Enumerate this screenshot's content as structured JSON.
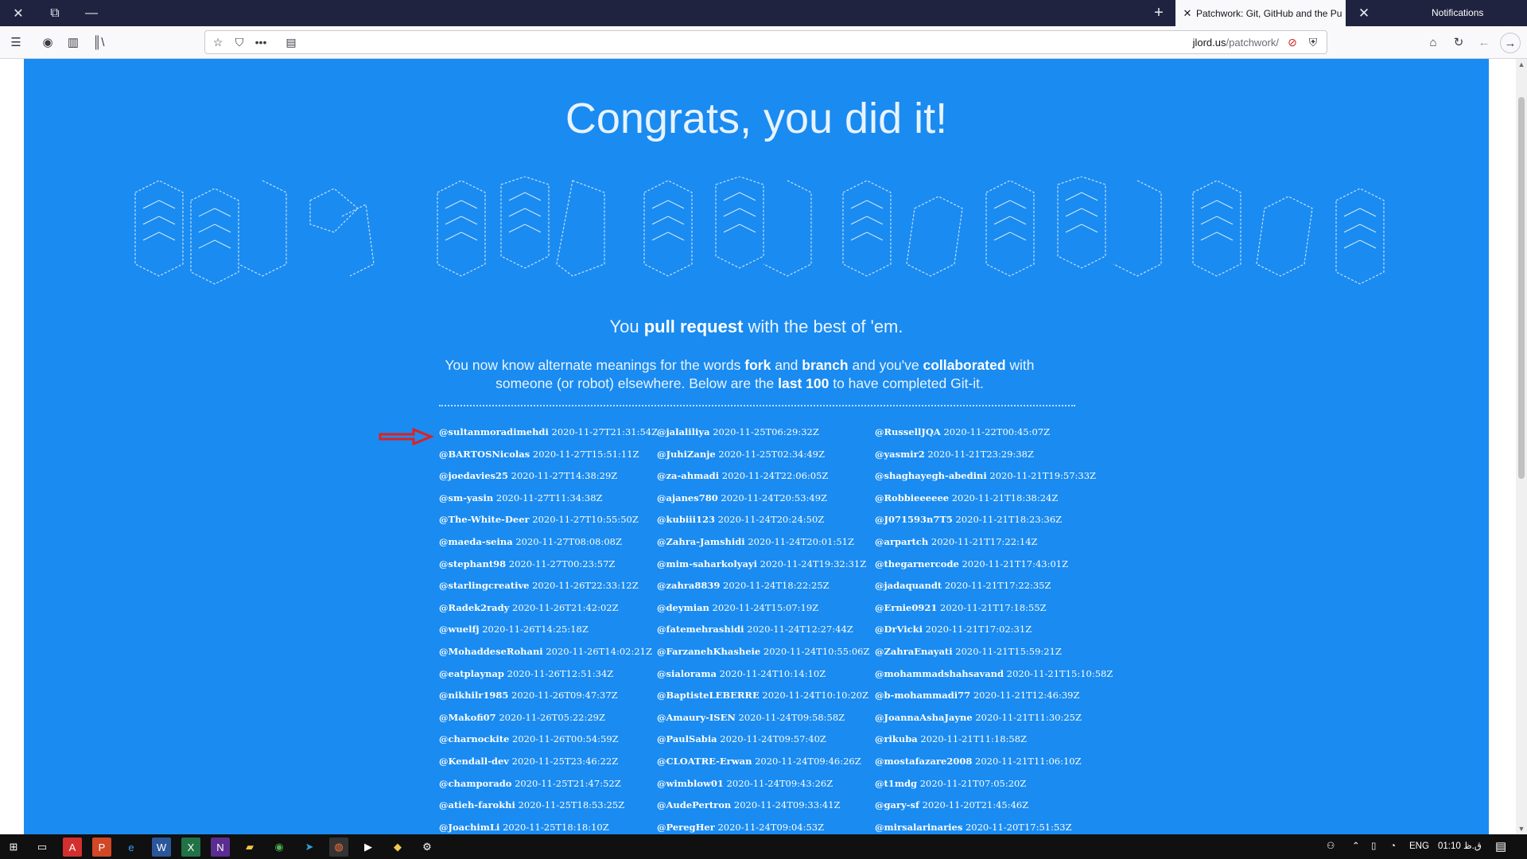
{
  "browser": {
    "tab_title": "Patchwork: Git, GitHub and the Pu",
    "notifications_label": "Notifications",
    "url_host": "jlord.us",
    "url_path": "/patchwork/"
  },
  "page": {
    "heading": "Congrats, you did it!",
    "lead_prefix": "You ",
    "lead_bold": "pull request",
    "lead_suffix": " with the best of 'em.",
    "para_1": "You now know alternate meanings for the words ",
    "para_fork": "fork",
    "para_2": " and ",
    "para_branch": "branch",
    "para_3": " and you've ",
    "para_collab": "collaborated",
    "para_4": " with someone (or robot) elsewhere. Below are the ",
    "para_last": "last 100",
    "para_5": " to have completed Git-it."
  },
  "completions": [
    [
      {
        "user": "@sultanmoradimehdi",
        "time": "2020-11-27T21:31:54Z"
      },
      {
        "user": "@BARTOSNicolas",
        "time": "2020-11-27T15:51:11Z"
      },
      {
        "user": "@joedavies25",
        "time": "2020-11-27T14:38:29Z"
      },
      {
        "user": "@sm-yasin",
        "time": "2020-11-27T11:34:38Z"
      },
      {
        "user": "@The-White-Deer",
        "time": "2020-11-27T10:55:50Z"
      },
      {
        "user": "@maeda-seina",
        "time": "2020-11-27T08:08:08Z"
      },
      {
        "user": "@stephant98",
        "time": "2020-11-27T00:23:57Z"
      },
      {
        "user": "@starlingcreative",
        "time": "2020-11-26T22:33:12Z"
      },
      {
        "user": "@Radek2rady",
        "time": "2020-11-26T21:42:02Z"
      },
      {
        "user": "@wuelfj",
        "time": "2020-11-26T14:25:18Z"
      },
      {
        "user": "@MohaddeseRohani",
        "time": "2020-11-26T14:02:21Z"
      },
      {
        "user": "@eatplaynap",
        "time": "2020-11-26T12:51:34Z"
      },
      {
        "user": "@nikhilr1985",
        "time": "2020-11-26T09:47:37Z"
      },
      {
        "user": "@Makofi07",
        "time": "2020-11-26T05:22:29Z"
      },
      {
        "user": "@charnockite",
        "time": "2020-11-26T00:54:59Z"
      },
      {
        "user": "@Kendall-dev",
        "time": "2020-11-25T23:46:22Z"
      },
      {
        "user": "@champorado",
        "time": "2020-11-25T21:47:52Z"
      },
      {
        "user": "@atieh-farokhi",
        "time": "2020-11-25T18:53:25Z"
      },
      {
        "user": "@JoachimLi",
        "time": "2020-11-25T18:18:10Z"
      }
    ],
    [
      {
        "user": "@jalaliliya",
        "time": "2020-11-25T06:29:32Z"
      },
      {
        "user": "@JuhiZanje",
        "time": "2020-11-25T02:34:49Z"
      },
      {
        "user": "@za-ahmadi",
        "time": "2020-11-24T22:06:05Z"
      },
      {
        "user": "@ajanes780",
        "time": "2020-11-24T20:53:49Z"
      },
      {
        "user": "@kubiii123",
        "time": "2020-11-24T20:24:50Z"
      },
      {
        "user": "@Zahra-Jamshidi",
        "time": "2020-11-24T20:01:51Z"
      },
      {
        "user": "@mim-saharkolyayi",
        "time": "2020-11-24T19:32:31Z"
      },
      {
        "user": "@zahra8839",
        "time": "2020-11-24T18:22:25Z"
      },
      {
        "user": "@deymian",
        "time": "2020-11-24T15:07:19Z"
      },
      {
        "user": "@fatemehrashidi",
        "time": "2020-11-24T12:27:44Z"
      },
      {
        "user": "@FarzanehKhasheie",
        "time": "2020-11-24T10:55:06Z"
      },
      {
        "user": "@sialorama",
        "time": "2020-11-24T10:14:10Z"
      },
      {
        "user": "@BaptisteLEBERRE",
        "time": "2020-11-24T10:10:20Z"
      },
      {
        "user": "@Amaury-ISEN",
        "time": "2020-11-24T09:58:58Z"
      },
      {
        "user": "@PaulSabia",
        "time": "2020-11-24T09:57:40Z"
      },
      {
        "user": "@CLOATRE-Erwan",
        "time": "2020-11-24T09:46:26Z"
      },
      {
        "user": "@wimblow01",
        "time": "2020-11-24T09:43:26Z"
      },
      {
        "user": "@AudePertron",
        "time": "2020-11-24T09:33:41Z"
      },
      {
        "user": "@PeregHer",
        "time": "2020-11-24T09:04:53Z"
      }
    ],
    [
      {
        "user": "@RussellJQA",
        "time": "2020-11-22T00:45:07Z"
      },
      {
        "user": "@yasmir2",
        "time": "2020-11-21T23:29:38Z"
      },
      {
        "user": "@shaghayegh-abedini",
        "time": "2020-11-21T19:57:33Z"
      },
      {
        "user": "@Robbieeeeee",
        "time": "2020-11-21T18:38:24Z"
      },
      {
        "user": "@J071593n7T5",
        "time": "2020-11-21T18:23:36Z"
      },
      {
        "user": "@arpartch",
        "time": "2020-11-21T17:22:14Z"
      },
      {
        "user": "@thegarnercode",
        "time": "2020-11-21T17:43:01Z"
      },
      {
        "user": "@jadaquandt",
        "time": "2020-11-21T17:22:35Z"
      },
      {
        "user": "@Ernie0921",
        "time": "2020-11-21T17:18:55Z"
      },
      {
        "user": "@DrVicki",
        "time": "2020-11-21T17:02:31Z"
      },
      {
        "user": "@ZahraEnayati",
        "time": "2020-11-21T15:59:21Z"
      },
      {
        "user": "@mohammadshahsavand",
        "time": "2020-11-21T15:10:58Z"
      },
      {
        "user": "@b-mohammadi77",
        "time": "2020-11-21T12:46:39Z"
      },
      {
        "user": "@JoannaAshaJayne",
        "time": "2020-11-21T11:30:25Z"
      },
      {
        "user": "@rikuba",
        "time": "2020-11-21T11:18:58Z"
      },
      {
        "user": "@mostafazare2008",
        "time": "2020-11-21T11:06:10Z"
      },
      {
        "user": "@t1mdg",
        "time": "2020-11-21T07:05:20Z"
      },
      {
        "user": "@gary-sf",
        "time": "2020-11-20T21:45:46Z"
      },
      {
        "user": "@mirsalarinaries",
        "time": "2020-11-20T17:51:53Z"
      }
    ]
  ],
  "taskbar": {
    "language": "ENG",
    "clock": "01:10 ق.ظ"
  },
  "icons": {
    "back": "arrow-left-icon",
    "forward": "arrow-right-icon",
    "reload": "reload-icon",
    "home": "home-icon"
  },
  "colors": {
    "page_bg": "#1a8bf0",
    "tab_strip": "#202340",
    "arrow": "#e02020"
  }
}
